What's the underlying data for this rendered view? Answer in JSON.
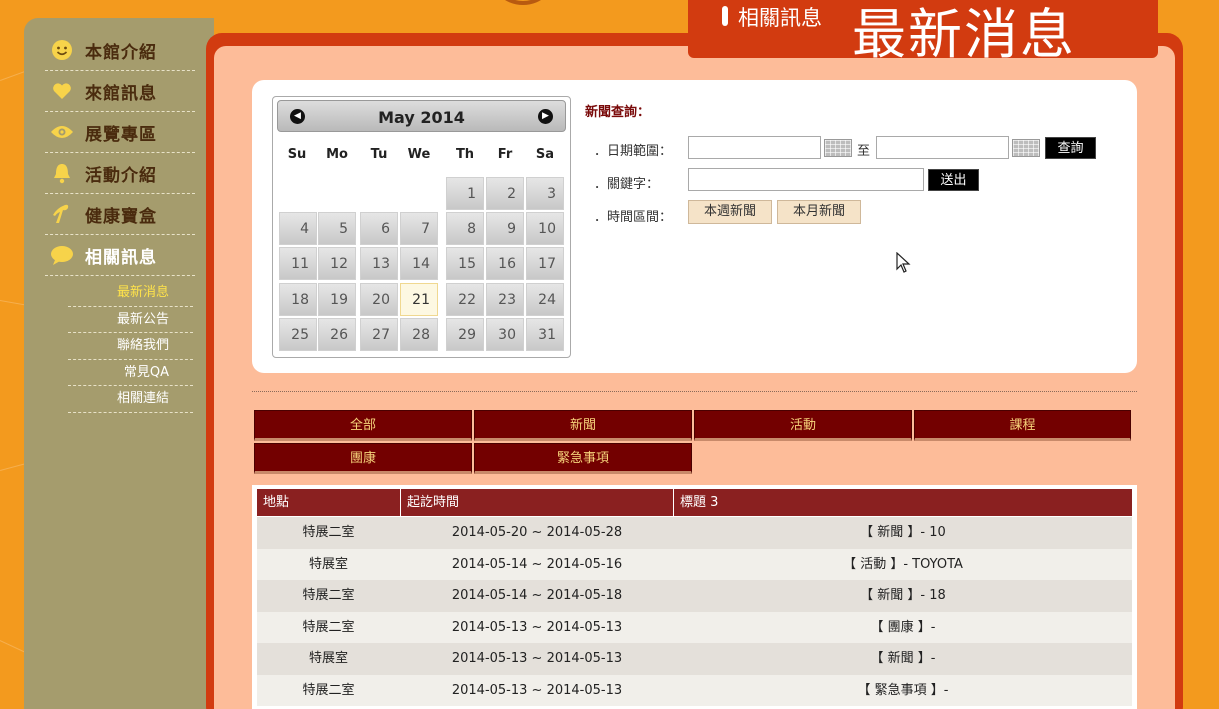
{
  "header": {
    "section_label": "相關訊息",
    "page_title": "最新消息"
  },
  "sidebar": {
    "items": [
      {
        "label": "本館介紹",
        "icon": "smiley-icon"
      },
      {
        "label": "來館訊息",
        "icon": "heart-icon"
      },
      {
        "label": "展覽專區",
        "icon": "eye-icon"
      },
      {
        "label": "活動介紹",
        "icon": "bell-icon"
      },
      {
        "label": "健康寶盒",
        "icon": "runner-icon"
      },
      {
        "label": "相關訊息",
        "icon": "speech-bubble-icon"
      }
    ],
    "active_index": 5,
    "subitems": [
      "最新消息",
      "最新公告",
      "聯絡我們",
      "常見QA",
      "相關連結"
    ],
    "active_subitem": 0
  },
  "calendar": {
    "title": "May 2014",
    "prev_label": "◀",
    "next_label": "▶",
    "weekdays": [
      "Su",
      "Mo",
      "Tu",
      "We",
      "Th",
      "Fr",
      "Sa"
    ],
    "days": [
      "1",
      "2",
      "3",
      "4",
      "5",
      "6",
      "7",
      "8",
      "9",
      "10",
      "11",
      "12",
      "13",
      "14",
      "15",
      "16",
      "17",
      "18",
      "19",
      "20",
      "21",
      "22",
      "23",
      "24",
      "25",
      "26",
      "27",
      "28",
      "29",
      "30",
      "31"
    ],
    "first_weekday": 4,
    "today": "21"
  },
  "search": {
    "title": "新聞查詢：",
    "date_range_label": "．日期範圍：",
    "to_label": "至",
    "query_button": "查詢",
    "keyword_label": "．關鍵字：",
    "submit_button": "送出",
    "period_label": "．時間區間：",
    "this_week_button": "本週新聞",
    "this_month_button": "本月新聞",
    "date_from_value": "",
    "date_to_value": "",
    "keyword_value": ""
  },
  "categories": [
    "全部",
    "新聞",
    "活動",
    "課程",
    "團康",
    "緊急事項"
  ],
  "table": {
    "headers": [
      "地點",
      "起訖時間",
      "標題 3"
    ],
    "rows": [
      [
        "特展二室",
        "2014-05-20 ~ 2014-05-28",
        "【 新聞 】- 10"
      ],
      [
        "特展室",
        "2014-05-14 ~ 2014-05-16",
        "【 活動 】- TOYOTA"
      ],
      [
        "特展二室",
        "2014-05-14 ~ 2014-05-18",
        "【 新聞 】- 18"
      ],
      [
        "特展二室",
        "2014-05-13 ~ 2014-05-13",
        "【 團康 】-"
      ],
      [
        "特展室",
        "2014-05-13 ~ 2014-05-13",
        "【 新聞 】-"
      ],
      [
        "特展二室",
        "2014-05-13 ~ 2014-05-13",
        "【 緊急事項 】-"
      ]
    ]
  },
  "colors": {
    "background": "#f39a1e",
    "panel_red": "#d23b10",
    "panel_peach": "#fdbc99",
    "sidebar": "#a59c6d",
    "tab_dark_red": "#730000",
    "tab_text": "#f6d27a",
    "table_header": "#8a2020"
  }
}
